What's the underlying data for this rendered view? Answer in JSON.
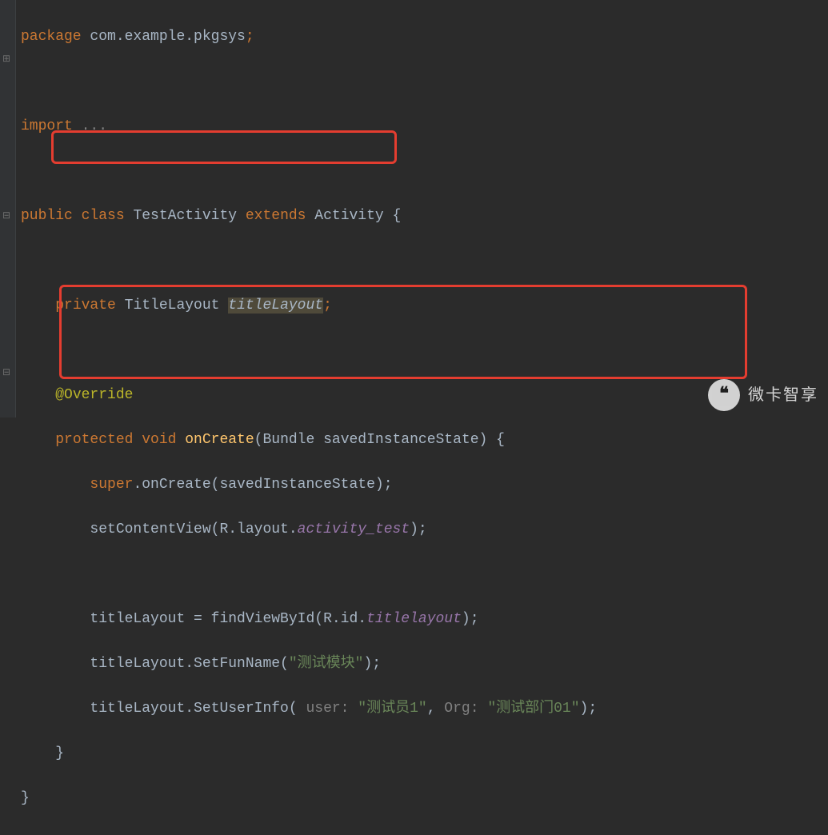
{
  "code": {
    "line1": {
      "kw1": "package ",
      "id": "com.example.pkgsys",
      "semi": ";"
    },
    "line3": {
      "kw1": "import ",
      "dots": "..."
    },
    "line5": {
      "kw1": "public class ",
      "id1": "TestActivity ",
      "kw2": "extends ",
      "id2": "Activity {"
    },
    "line7": {
      "indent": "    ",
      "kw1": "private ",
      "id1": "TitleLayout ",
      "var": "titleLayout",
      "semi": ";"
    },
    "line9": {
      "indent": "    ",
      "ann": "@Override"
    },
    "line10": {
      "indent": "    ",
      "kw1": "protected void ",
      "fn": "onCreate",
      "sig": "(Bundle savedInstanceState) {"
    },
    "line11": {
      "indent": "        ",
      "kw1": "super",
      "dot": ".onCreate(savedInstanceState);"
    },
    "line12": {
      "indent": "        ",
      "id1": "setContentView(R.layout.",
      "it": "activity_test",
      "close": ");"
    },
    "line14": {
      "indent": "        ",
      "id1": "titleLayout = findViewById(R.id.",
      "it": "titlelayout",
      "close": ");"
    },
    "line15": {
      "indent": "        ",
      "id1": "titleLayout.SetFunName(",
      "str": "\"测试模块\"",
      "close": ");"
    },
    "line16": {
      "indent": "        ",
      "id1": "titleLayout.SetUserInfo( ",
      "p1": "user: ",
      "s1": "\"测试员1\"",
      "c": ", ",
      "p2": "Org: ",
      "s2": "\"测试部门01\"",
      "close": ");"
    },
    "line17": {
      "indent": "    ",
      "brace": "}"
    },
    "line18": {
      "brace": "}"
    }
  },
  "gutter": {
    "expand": "⊞",
    "collapse": "⊟"
  },
  "watermark": {
    "icon": "❝",
    "text": "微卡智享"
  }
}
